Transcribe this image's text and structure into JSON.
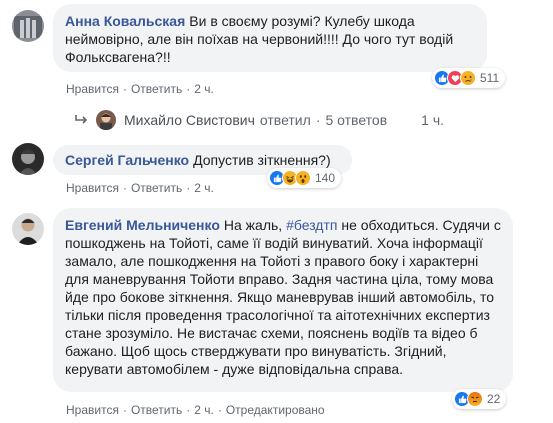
{
  "comments": [
    {
      "author": "Анна Ковальская",
      "text": "Ви в своєму розумі? Кулебу шкода неймовірно, але він поїхав на червоний!!!! До чого тут водій Фольксвагена?!!",
      "actions": [
        "Нравится",
        "Ответить",
        "2 ч."
      ],
      "reaction_count": "511",
      "reaction_icons": [
        "like-icon",
        "love-icon",
        "sad-icon"
      ]
    },
    {
      "author": "Сергей Гальченко",
      "text": "Допустив зіткнення?)",
      "actions": [
        "Нравится",
        "Ответить",
        "2 ч."
      ],
      "reaction_count": "140",
      "reaction_icons": [
        "like-icon",
        "haha-icon",
        "wow-icon"
      ]
    },
    {
      "author": "Евгений Мельниченко",
      "text_before": "На жаль, ",
      "hashtag": "#бездтп",
      "text_after": " не обходиться. Судячи с пошкоджень на Тойоті, саме її водій винуватий. Хоча інформації замало, але пошкодження на Тойоті з правого боку і характерні для маневрування Тойоти вправо. Задня частина ціла, тому мова йде про бокове зіткнення. Якщо маневрував інший автомобіль, то тільки після проведення трасологічної та аітотехнічних експертиз стане зрозуміло. Не вистачає схеми, пояснень водіїв та відео б бажано. Щоб щось стверджувати про винуватість. Згідний, керувати автомобілем - дуже відповідальна справа.",
      "actions": [
        "Нравится",
        "Ответить",
        "2 ч.",
        "Отредактировано"
      ],
      "reaction_count": "22",
      "reaction_icons": [
        "like-icon",
        "angry-icon"
      ]
    }
  ],
  "reply_summary": {
    "name": "Михайло Свистович",
    "verb": "ответил",
    "count_text": "5 ответов",
    "time": "1 ч."
  },
  "colors": {
    "link": "#385898",
    "bubble": "#f2f3f5",
    "meta": "#606770"
  }
}
